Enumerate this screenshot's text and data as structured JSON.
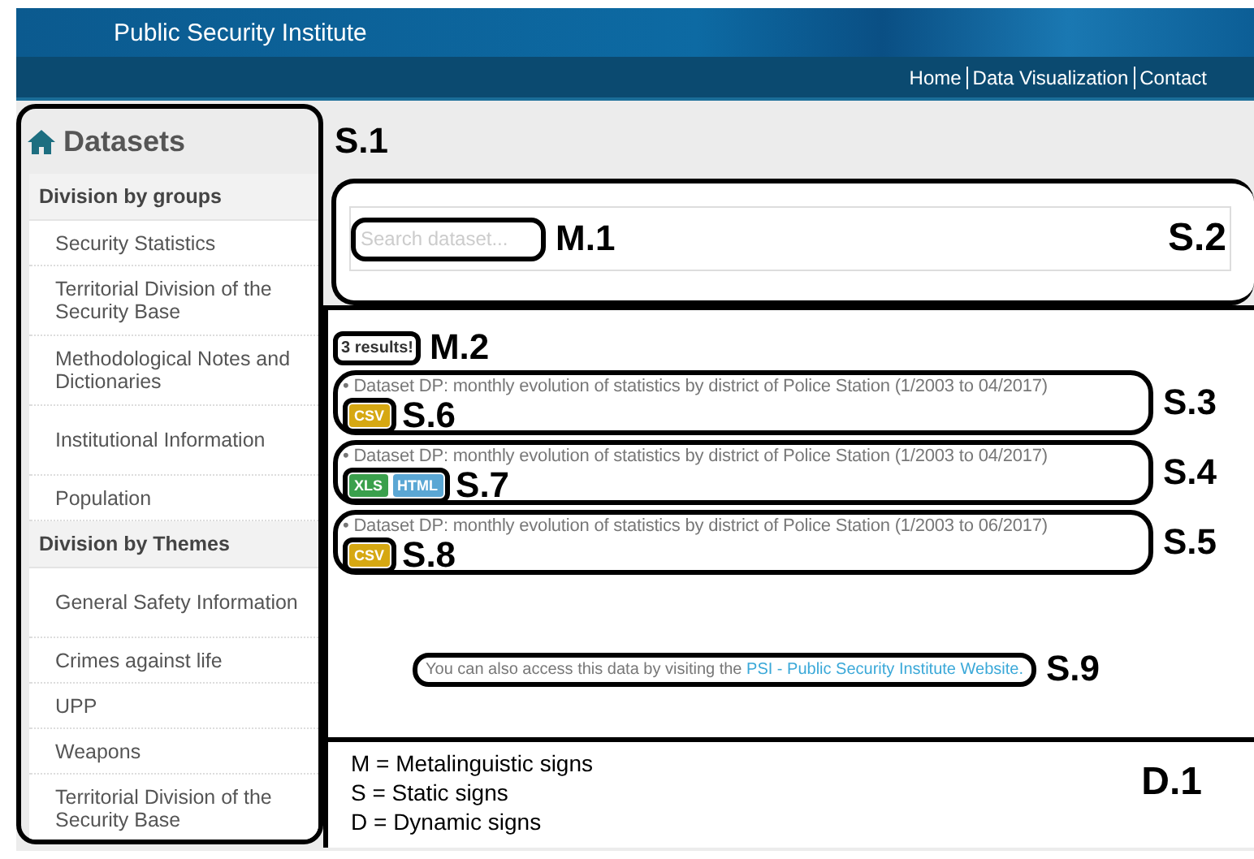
{
  "header": {
    "title": "Public Security Institute",
    "nav": [
      "Home",
      "Data Visualization",
      "Contact"
    ]
  },
  "sidebar": {
    "title": "Datasets",
    "sections": [
      {
        "heading": "Division by groups",
        "items": [
          "Security Statistics",
          "Territorial Division of the Security Base",
          "Methodological Notes and Dictionaries",
          "Institutional Information",
          "Population"
        ]
      },
      {
        "heading": "Division by Themes",
        "items": [
          "General Safety Information",
          "Crimes against life",
          "UPP",
          "Weapons",
          "Territorial Division of the Security Base"
        ]
      }
    ]
  },
  "sidebar_annotation": "S.1",
  "search": {
    "placeholder": "Search dataset...",
    "field_annotation": "M.1",
    "annotation": "S.2"
  },
  "results": {
    "count": "3 results!",
    "count_annotation": "M.2",
    "datasets": [
      {
        "title": "• Dataset DP: monthly evolution of statistics by district of Police Station (1/2003 to 04/2017)",
        "annotation": "S.3",
        "formats_annotation": "S.6",
        "formats": [
          {
            "label": "CSV",
            "color": "#d6a812"
          }
        ]
      },
      {
        "title": "• Dataset DP: monthly evolution of statistics by district of Police Station (1/2003 to 04/2017)",
        "annotation": "S.4",
        "formats_annotation": "S.7",
        "formats": [
          {
            "label": "XLS",
            "color": "#3aa04c"
          },
          {
            "label": "HTML",
            "color": "#5ba7d4"
          }
        ]
      },
      {
        "title": "• Dataset DP: monthly evolution of statistics by district of Police Station (1/2003 to 06/2017)",
        "annotation": "S.5",
        "formats_annotation": "S.8",
        "formats": [
          {
            "label": "CSV",
            "color": "#d6a812"
          }
        ]
      }
    ]
  },
  "notice": {
    "text": "You can also access this data by visiting the ",
    "link": "PSI - Public Security Institute Website.",
    "annotation": "S.9"
  },
  "legend": {
    "lines": [
      "M = Metalinguistic signs",
      "S = Static signs",
      "D = Dynamic signs"
    ],
    "annotation": "D.1"
  }
}
